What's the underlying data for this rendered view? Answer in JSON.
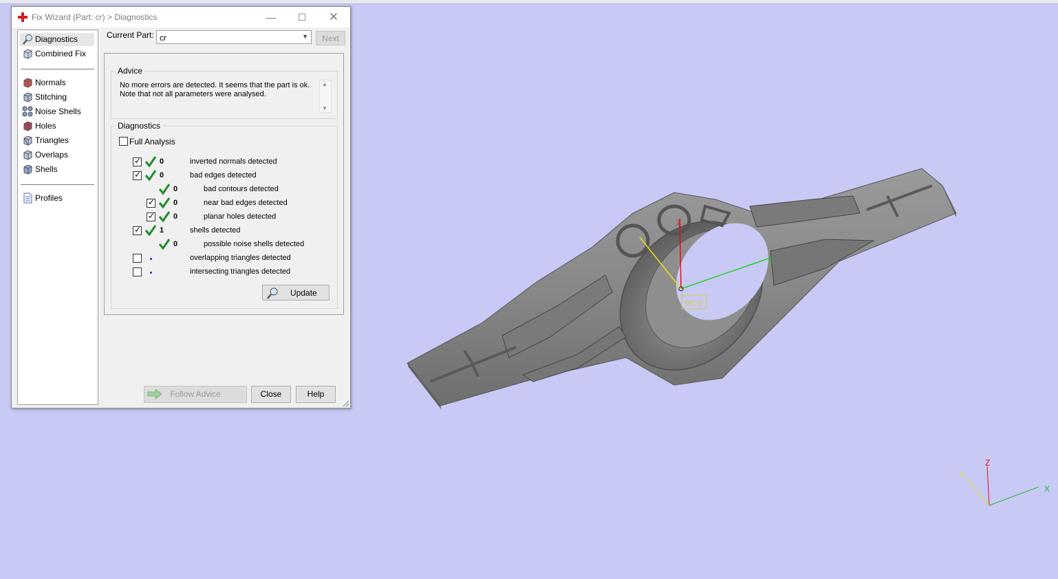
{
  "dialog": {
    "title": "Fix Wizard (Part: cr) > Diagnostics",
    "nav_items": [
      "Diagnostics",
      "Combined Fix",
      "Normals",
      "Stitching",
      "Noise Shells",
      "Holes",
      "Triangles",
      "Overlaps",
      "Shells",
      "Profiles"
    ],
    "selected_nav": "Diagnostics",
    "current_part_label": "Current Part:",
    "current_part_value": "cr",
    "next_label": "Next",
    "advice": {
      "title": "Advice",
      "text": "No more errors are detected. It seems that the part is ok. Note that not all parameters were analysed."
    },
    "diagnostics": {
      "title": "Diagnostics",
      "full_analysis_label": "Full Analysis",
      "full_analysis_checked": false,
      "rows": [
        {
          "checked": true,
          "status": "ok",
          "count": "0",
          "label": "inverted normals detected",
          "indent": 0
        },
        {
          "checked": true,
          "status": "ok",
          "count": "0",
          "label": "bad edges detected",
          "indent": 0
        },
        {
          "checked": null,
          "status": "ok",
          "count": "0",
          "label": "bad contours detected",
          "indent": 1
        },
        {
          "checked": true,
          "status": "ok",
          "count": "0",
          "label": "near bad edges detected",
          "indent": 1
        },
        {
          "checked": true,
          "status": "ok",
          "count": "0",
          "label": "planar holes detected",
          "indent": 1
        },
        {
          "checked": true,
          "status": "ok",
          "count": "1",
          "label": "shells detected",
          "indent": 0
        },
        {
          "checked": null,
          "status": "ok",
          "count": "0",
          "label": "possible noise shells detected",
          "indent": 1
        },
        {
          "checked": false,
          "status": "none",
          "count": "",
          "label": "overlapping triangles detected",
          "indent": 0
        },
        {
          "checked": false,
          "status": "none",
          "count": "",
          "label": "intersecting triangles detected",
          "indent": 0
        }
      ],
      "update_label": "Update"
    },
    "buttons": {
      "follow_advice": "Follow Advice",
      "close": "Close",
      "help": "Help"
    }
  },
  "viewport": {
    "background": "#c9c9f6",
    "wcs_label": "WCS",
    "axis_labels": {
      "x": "X",
      "y": "Y",
      "z": "Z"
    }
  }
}
